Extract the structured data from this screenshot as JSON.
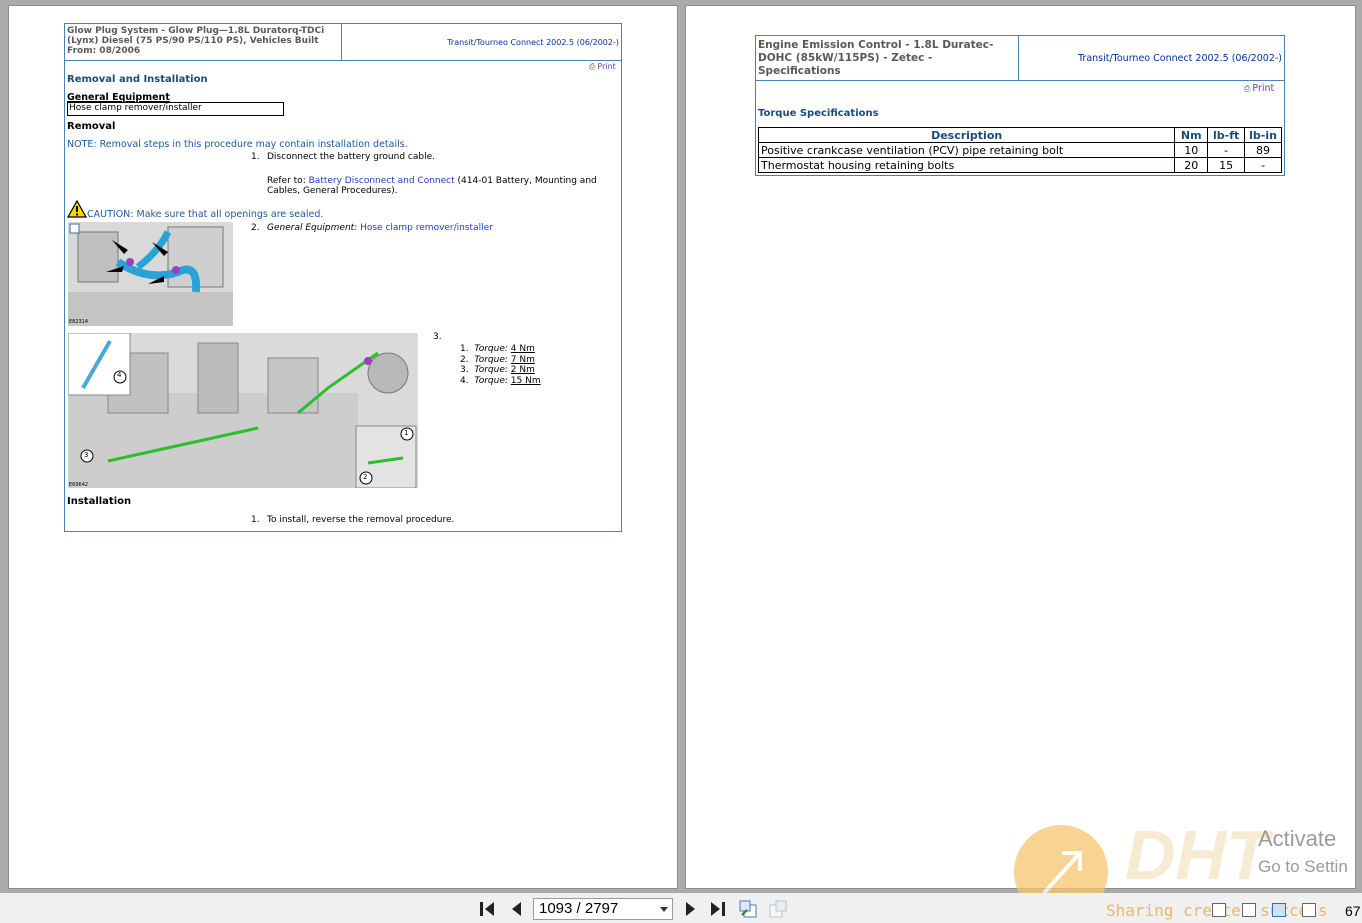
{
  "left_doc": {
    "header_title": "Glow Plug System - Glow Plug—1.8L Duratorq-TDCi (Lynx) Diesel (75 PS/90 PS/110 PS), Vehicles Built From: 08/2006",
    "header_vehicle": "Transit/Tourneo Connect 2002.5 (06/2002-)",
    "print": "Print",
    "section_title": "Removal and Installation",
    "general_equipment_label": "General Equipment",
    "general_equipment_item": "Hose clamp remover/installer",
    "removal_label": "Removal",
    "note": "NOTE: Removal steps in this procedure may contain installation details.",
    "step1_num": "1.",
    "step1_text": "Disconnect the battery ground cable.",
    "refer_prefix": "Refer to:",
    "refer_link": "Battery Disconnect and Connect",
    "refer_suffix": "(414-01 Battery, Mounting and",
    "refer_suffix2": "Cables, General Procedures).",
    "caution": "CAUTION: Make sure that all openings are sealed.",
    "step2_num": "2.",
    "step2_prefix": "General Equipment:",
    "step2_link": "Hose clamp remover/installer",
    "illus1_id": "E82314",
    "illus2_id": "E69642",
    "step3_num": "3.",
    "torques": [
      {
        "num": "1.",
        "label": "Torque:",
        "value": "4 Nm"
      },
      {
        "num": "2.",
        "label": "Torque:",
        "value": "7 Nm"
      },
      {
        "num": "3.",
        "label": "Torque:",
        "value": "2 Nm"
      },
      {
        "num": "4.",
        "label": "Torque:",
        "value": "15 Nm"
      }
    ],
    "callouts": [
      "4",
      "3",
      "1",
      "2"
    ],
    "installation_label": "Installation",
    "install_step_num": "1.",
    "install_step_text": "To install, reverse the removal procedure."
  },
  "right_doc": {
    "header_title": "Engine Emission Control - 1.8L Duratec-DOHC (85kW/115PS) - Zetec - Specifications",
    "header_vehicle": "Transit/Tourneo Connect 2002.5 (06/2002-)",
    "print": "Print",
    "section_title": "Torque Specifications",
    "table_headers": [
      "Description",
      "Nm",
      "lb-ft",
      "lb-in"
    ],
    "rows": [
      [
        "Positive crankcase ventilation (PCV) pipe retaining bolt",
        "10",
        "-",
        "89"
      ],
      [
        "Thermostat housing retaining bolts",
        "20",
        "15",
        "-"
      ]
    ]
  },
  "toolbar": {
    "page_indicator": "1093 / 2797",
    "right_edge_number": "67"
  },
  "watermark": {
    "logo_text": "DHT",
    "activate_line1": "Activate",
    "activate_line2": "Go to Settin",
    "sharing": "Sharing creates success"
  }
}
